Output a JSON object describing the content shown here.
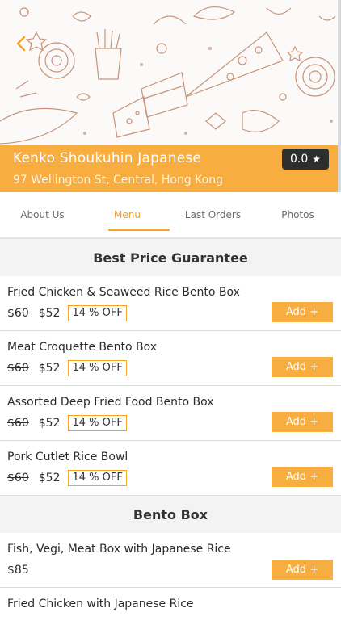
{
  "colors": {
    "accent": "#f7ad3f",
    "banner": "#f7ad3f",
    "rating_bg": "#2e2e2e",
    "section_bg": "#f3f3f3"
  },
  "header": {
    "back_icon": "chevron-left-icon",
    "restaurant_name": "Kenko Shoukuhin Japanese",
    "address": "97 Wellington St, Central, Hong Kong",
    "rating": "0.0",
    "rating_icon": "star-icon"
  },
  "tabs": [
    {
      "label": "About Us",
      "active": false
    },
    {
      "label": "Menu",
      "active": true
    },
    {
      "label": "Last Orders",
      "active": false
    },
    {
      "label": "Photos",
      "active": false
    }
  ],
  "sections": [
    {
      "title": "Best Price Guarantee",
      "items": [
        {
          "name": "Fried Chicken & Seaweed Rice Bento Box",
          "old_price": "$60",
          "price": "$52",
          "discount": "14 % OFF",
          "add_label": "Add +"
        },
        {
          "name": "Meat Croquette Bento Box",
          "old_price": "$60",
          "price": "$52",
          "discount": "14 % OFF",
          "add_label": "Add +"
        },
        {
          "name": "Assorted Deep Fried Food Bento Box",
          "old_price": "$60",
          "price": "$52",
          "discount": "14 % OFF",
          "add_label": "Add +"
        },
        {
          "name": "Pork Cutlet Rice Bowl",
          "old_price": "$60",
          "price": "$52",
          "discount": "14 % OFF",
          "add_label": "Add +"
        }
      ]
    },
    {
      "title": "Bento Box",
      "items": [
        {
          "name": "Fish, Vegi, Meat Box with Japanese Rice",
          "price": "$85",
          "add_label": "Add +"
        },
        {
          "name": "Fried Chicken with Japanese Rice"
        }
      ]
    }
  ]
}
